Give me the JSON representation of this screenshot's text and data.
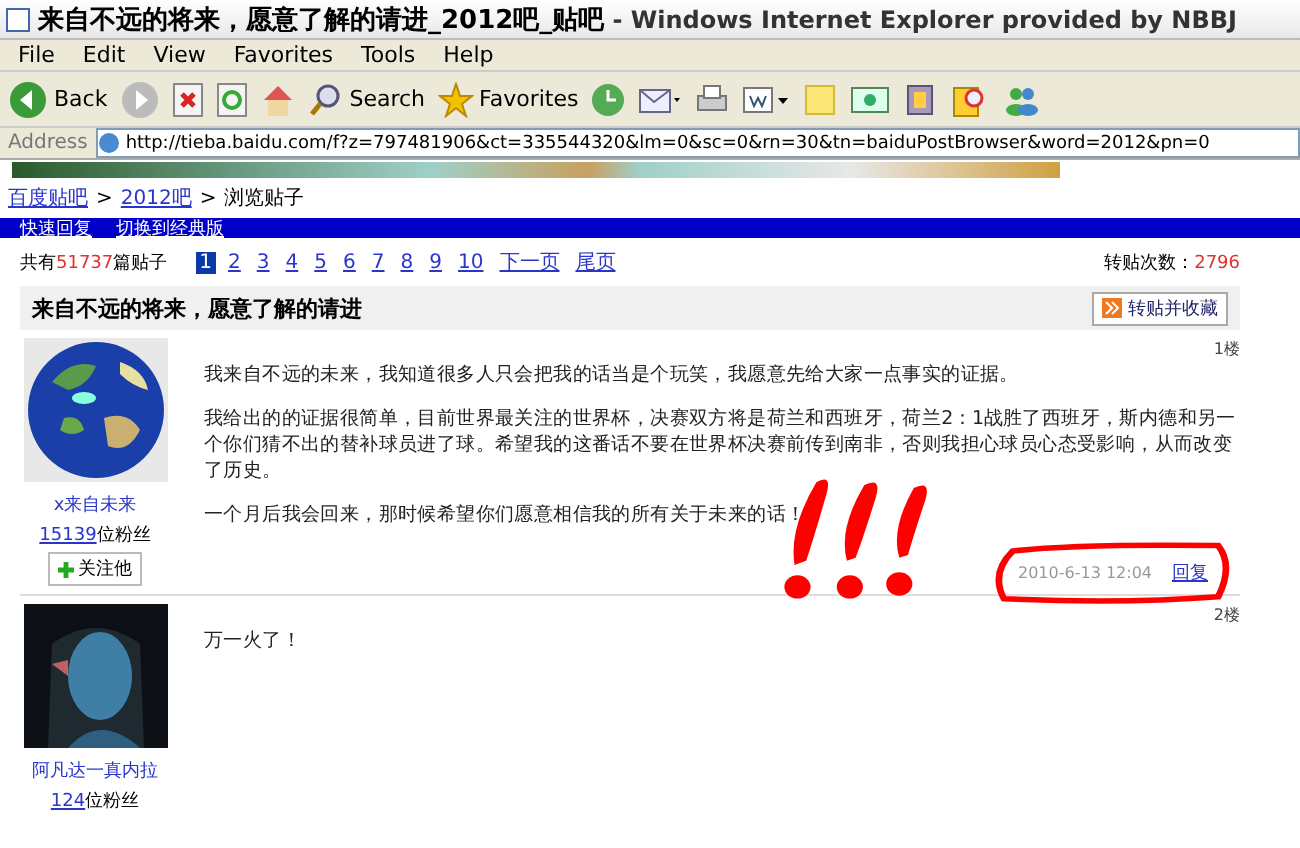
{
  "window": {
    "title": "来自不远的将来，愿意了解的请进_2012吧_贴吧",
    "app_title": "- Windows Internet Explorer provided by NBBJ"
  },
  "menu": [
    "File",
    "Edit",
    "View",
    "Favorites",
    "Tools",
    "Help"
  ],
  "toolbar": [
    {
      "kind": "back",
      "label": "Back"
    },
    {
      "kind": "forward"
    },
    {
      "kind": "stop"
    },
    {
      "kind": "refresh"
    },
    {
      "kind": "home"
    },
    {
      "kind": "search",
      "label": "Search"
    },
    {
      "kind": "favorites",
      "label": "Favorites"
    },
    {
      "kind": "history"
    },
    {
      "kind": "mail"
    },
    {
      "kind": "print"
    },
    {
      "kind": "edit"
    },
    {
      "kind": "note"
    },
    {
      "kind": "media"
    },
    {
      "kind": "tool"
    },
    {
      "kind": "research"
    },
    {
      "kind": "messenger"
    }
  ],
  "address": {
    "label": "Address",
    "value": "http://tieba.baidu.com/f?z=797481906&ct=335544320&lm=0&sc=0&rn=30&tn=baiduPostBrowser&word=2012&pn=0"
  },
  "breadcrumb": [
    "百度贴吧",
    "2012吧",
    "浏览贴子"
  ],
  "breadcrumb_separator": ">",
  "blue_bar": [
    "快速回复",
    "切换到经典版"
  ],
  "pager": {
    "prefix": "共有",
    "count": "51737",
    "suffix": "篇贴子",
    "pages": [
      {
        "label": "1",
        "selected": true
      },
      {
        "label": "2",
        "selected": false
      },
      {
        "label": "3",
        "selected": false
      },
      {
        "label": "4",
        "selected": false
      },
      {
        "label": "5",
        "selected": false
      },
      {
        "label": "6",
        "selected": false
      },
      {
        "label": "7",
        "selected": false
      },
      {
        "label": "8",
        "selected": false
      },
      {
        "label": "9",
        "selected": false
      },
      {
        "label": "10",
        "selected": false
      },
      {
        "label": "下一页",
        "selected": false
      },
      {
        "label": "尾页",
        "selected": false
      }
    ],
    "repost_label": "转贴次数：",
    "repost_count": "2796"
  },
  "thread": {
    "title": "来自不远的将来，愿意了解的请进",
    "action": "转贴并收藏"
  },
  "posts": [
    {
      "author": "x来自未来",
      "fans_count": "15139",
      "fans_label": "位粉丝",
      "follow": "关注他",
      "floor": "1楼",
      "paragraphs": [
        "我来自不远的未来，我知道很多人只会把我的话当是个玩笑，我愿意先给大家一点事实的证据。",
        "我给出的的证据很简单，目前世界最关注的世界杯，决赛双方将是荷兰和西班牙，荷兰2：1战胜了西班牙，斯内德和另一个你们猜不出的替补球员进了球。希望我的这番话不要在世界杯决赛前传到南非，否则我担心球员心态受影响，从而改变了历史。",
        "一个月后我会回来，那时候希望你们愿意相信我的所有关于未来的话！"
      ],
      "time": "2010-6-13 12:04",
      "reply": "回复"
    },
    {
      "author": "阿凡达一真内拉",
      "fans_count": "124",
      "fans_label": "位粉丝",
      "floor": "2楼",
      "paragraphs": [
        "万一火了！"
      ]
    }
  ]
}
